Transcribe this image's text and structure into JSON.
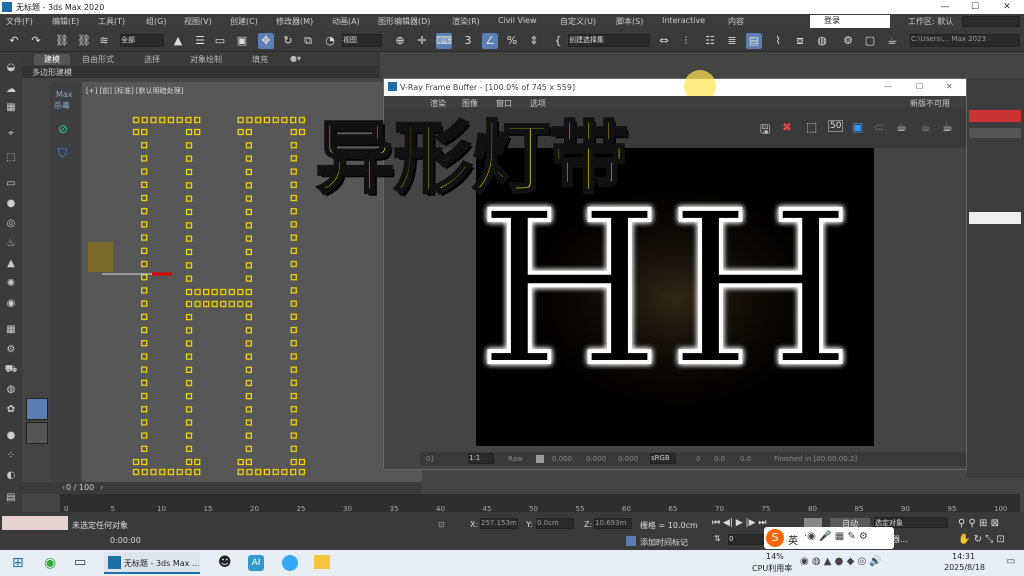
{
  "window": {
    "title": "无标题 - 3ds Max 2020",
    "min": "—",
    "max": "☐",
    "close": "✕"
  },
  "menubar": {
    "items": [
      "文件(F)",
      "编辑(E)",
      "工具(T)",
      "组(G)",
      "视图(V)",
      "创建(C)",
      "修改器(M)",
      "动画(A)",
      "图形编辑器(D)",
      "渲染(R)",
      "Civil View",
      "自定义(U)",
      "脚本(S)",
      "Interactive",
      "内容"
    ],
    "login": "登录",
    "workspace_label": "工作区: 默认"
  },
  "toolbar": {
    "filter": "全部",
    "view": "视图",
    "selection_set": "创建选择集",
    "path": "C:\\Users\\... Max 2023"
  },
  "ribbon": {
    "tabs": [
      "建模",
      "自由形式",
      "选择",
      "对象绘制",
      "填充"
    ],
    "sub": "多边形建模"
  },
  "viewport": {
    "label": "[+] [前] [标准] [默认明暗处理]"
  },
  "left_panel": {
    "max_label": "Max",
    "sub_label": "杀毒"
  },
  "vfb": {
    "title": "V-Ray Frame Buffer - [100.0% of 745 x 559]",
    "menu": [
      "渲染",
      "图像",
      "窗口",
      "选项"
    ],
    "right_label": "新版不可用",
    "zoom_btn": "50",
    "status": {
      "zoom": "1:1",
      "mode": "Raw",
      "v1": "0.000",
      "v2": "0.000",
      "v3": "0.000",
      "space": "sRGB",
      "c1": "0",
      "c2": "0.0",
      "c3": "0.0",
      "finished": "Finished in [00:00:00.2]",
      "left_num": "0]"
    }
  },
  "render_text": "HH",
  "overlay_title": "异形灯带",
  "timeline": {
    "frame": "0 / 100",
    "ticks": [
      "0",
      "5",
      "10",
      "15",
      "20",
      "25",
      "30",
      "35",
      "40",
      "45",
      "50",
      "55",
      "60",
      "65",
      "70",
      "75",
      "80",
      "85",
      "90",
      "95",
      "100"
    ]
  },
  "status": {
    "selection": "未选定任何对象",
    "time": "0:00:00",
    "x_label": "X:",
    "x_val": "257.153m",
    "y_label": "Y:",
    "y_val": "0.0cm",
    "z_label": "Z:",
    "z_val": "10.693m",
    "grid": "栅格 = 10.0cm",
    "add_time_tag": "添加时间标记",
    "auto_key": "自动",
    "selected_obj": "选定对象",
    "key_filters": "过滤器...",
    "frame_field": "0"
  },
  "taskbar": {
    "app_label": "无标题 - 3ds Max ...",
    "cpu_pct": "14%",
    "cpu_label": "CPU利用率",
    "clock_time": "14:31",
    "clock_date": "2025/8/18",
    "ime": "英"
  },
  "colors": {
    "accent": "#5a7fb5",
    "overlay": "#f3ef00",
    "led": "#f0d000"
  }
}
